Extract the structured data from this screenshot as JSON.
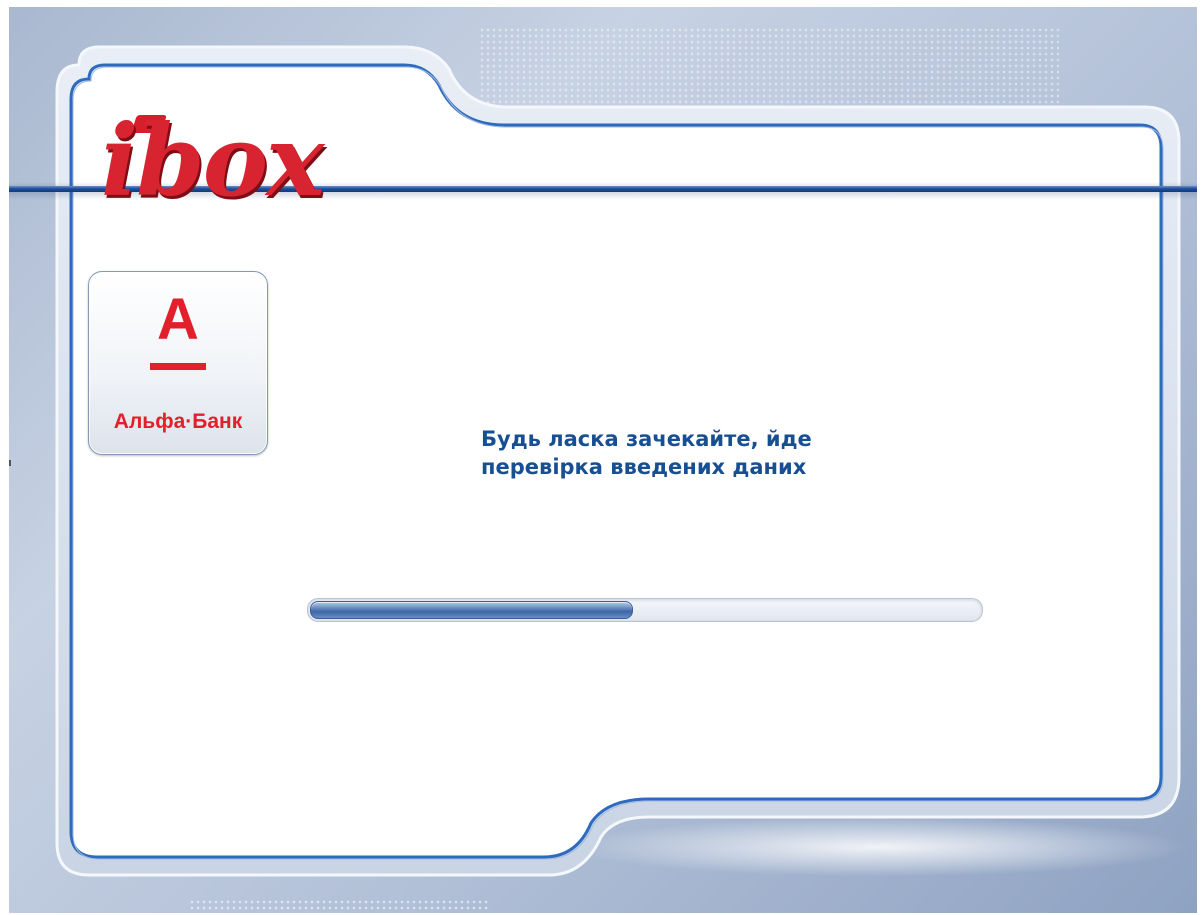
{
  "app": {
    "logo_text": "ibox"
  },
  "bank": {
    "letter": "А",
    "name": "Альфа·Банк",
    "color": "#e1202b"
  },
  "status": {
    "line1": "Будь ласка зачекайте, йде",
    "line2": "перевірка введених даних"
  },
  "progress": {
    "fraction": 0.48
  },
  "colors": {
    "accent": "#184f92",
    "brand_red": "#d61f2a",
    "frame": "#a9b8d0"
  }
}
